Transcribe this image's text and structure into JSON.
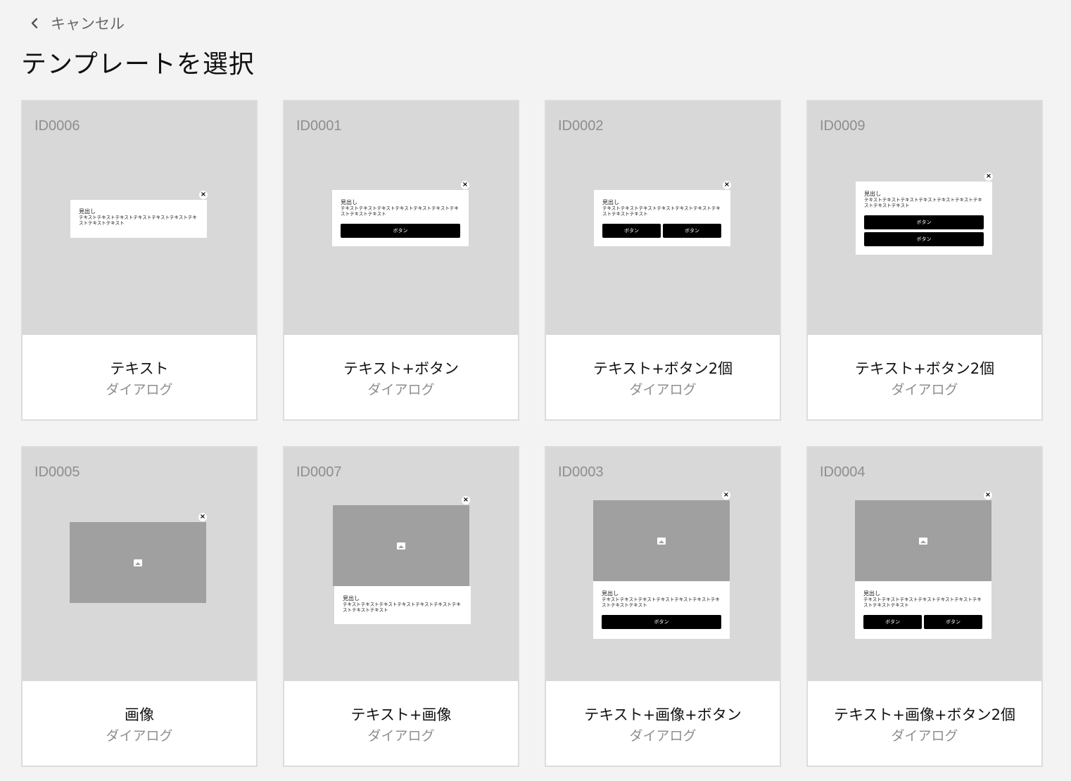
{
  "nav": {
    "back_label": "キャンセル"
  },
  "page": {
    "title": "テンプレートを選択"
  },
  "mock": {
    "heading": "見出し",
    "body": "テキストテキストテキストテキストテキストテキストテキストテキストテキスト",
    "button": "ボタン"
  },
  "cards": [
    {
      "id": "ID0006",
      "name": "テキスト",
      "type": "ダイアログ"
    },
    {
      "id": "ID0001",
      "name": "テキスト+ボタン",
      "type": "ダイアログ"
    },
    {
      "id": "ID0002",
      "name": "テキスト+ボタン2個",
      "type": "ダイアログ"
    },
    {
      "id": "ID0009",
      "name": "テキスト+ボタン2個",
      "type": "ダイアログ"
    },
    {
      "id": "ID0005",
      "name": "画像",
      "type": "ダイアログ"
    },
    {
      "id": "ID0007",
      "name": "テキスト+画像",
      "type": "ダイアログ"
    },
    {
      "id": "ID0003",
      "name": "テキスト+画像+ボタン",
      "type": "ダイアログ"
    },
    {
      "id": "ID0004",
      "name": "テキスト+画像+ボタン2個",
      "type": "ダイアログ"
    }
  ]
}
